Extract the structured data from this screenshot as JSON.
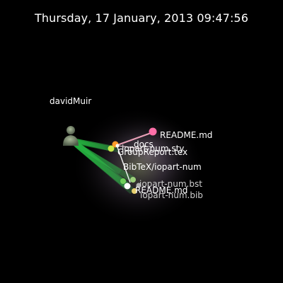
{
  "timestamp": "Thursday, 17 January, 2013 09:47:56",
  "user": {
    "name": "davidMuir",
    "icon": "user-avatar-icon"
  },
  "files": [
    {
      "label": "README.md",
      "color": "#ff6fa8"
    },
    {
      "label": "docs",
      "color": "#ffffff"
    },
    {
      "label": "iopart-num.sty",
      "color": "#ff9a2a"
    },
    {
      "label": "GroupReport.tex",
      "color": "#c8e84a"
    },
    {
      "label": "BibTeX/iopart-num",
      "color": "#ffffff"
    },
    {
      "label": "iopart-num.bst",
      "color": "#dddddd"
    },
    {
      "label": "README.md",
      "color": "#ffffff"
    },
    {
      "label": "iopart-num.bib",
      "color": "#dddddd"
    }
  ],
  "colors": {
    "background": "#000000",
    "beam": "#3bd84a",
    "branch": "#ffb0c8",
    "glow": "#9aa66a"
  }
}
